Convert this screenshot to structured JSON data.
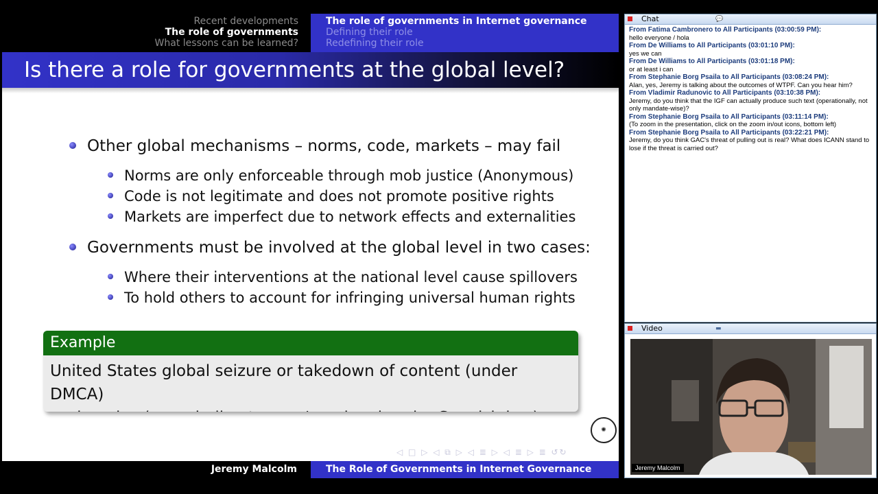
{
  "slide": {
    "nav_left": [
      "Recent developments",
      "The role of governments",
      "What lessons can be learned?"
    ],
    "nav_right": [
      "The role of governments in Internet governance",
      "Defining their role",
      "Redefining their role"
    ],
    "title": "Is there a role for governments at the global level?",
    "bullet1": "Other global mechanisms – norms, code, markets – may fail",
    "sub1": [
      "Norms are only enforceable through mob justice (Anonymous)",
      "Code is not legitimate and does not promote positive rights",
      "Markets are imperfect due to network effects and externalities"
    ],
    "bullet2": "Governments must be involved at the global level in two cases:",
    "sub2": [
      "Where their interventions at the national level cause spillovers",
      "To hold others to account for infringing universal human rights"
    ],
    "example_title": "Example",
    "example_line1": "United States global seizure or takedown of content (under DMCA)",
    "example_line2": "or domains (eg. rojedirecta.com/.org legal under Spanish law)",
    "beamer_nav": "◁ □ ▷ ◁ ⧉ ▷ ◁ ≣ ▷ ◁ ≣ ▷ ≣ ↺↻",
    "footer_author": "Jeremy Malcolm",
    "footer_title": "The Role of Governments in Internet Governance"
  },
  "chat": {
    "title": "Chat",
    "messages": [
      {
        "from": "From Fatima Cambronero to All Participants (03:00:59 PM):",
        "text": "hello everyone / hola"
      },
      {
        "from": "From De Williams to All Participants (03:01:10 PM):",
        "text": "yes we can"
      },
      {
        "from": "From De Williams to All Participants (03:01:18 PM):",
        "text": "or at least i can"
      },
      {
        "from": "From Stephanie Borg Psaila to All Participants (03:08:24 PM):",
        "text": "Alan, yes, Jeremy is talking about the outcomes of WTPF. Can you hear him?"
      },
      {
        "from": "From Vladimir Radunovic to All Participants (03:10:38 PM):",
        "text": "Jeremy, do you think that the IGF can actually produce such text (operationally, not only mandate-wise)?"
      },
      {
        "from": "From Stephanie Borg Psaila to All Participants (03:11:14 PM):",
        "text": "(To zoom in the presentation, click on the zoom in/out icons, bottom left)"
      },
      {
        "from": "From Stephanie Borg Psaila to All Participants (03:22:21 PM):",
        "text": "Jeremy, do you think GAC's threat of pulling out is real? What does ICANN stand to lose if the threat is carried out?"
      }
    ]
  },
  "video": {
    "title": "Video",
    "speaker": "Jeremy Malcolm"
  }
}
